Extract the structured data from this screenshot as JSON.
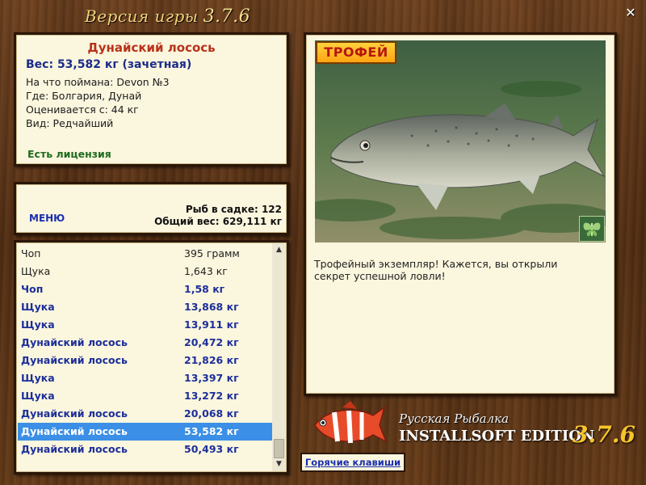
{
  "window": {
    "title": "Версия игры",
    "version": "3.7.6"
  },
  "fish": {
    "name": "Дунайский лосось",
    "weight": "Вес: 53,582 кг (зачетная)",
    "lines": [
      "На что поймана: Devon №3",
      "Где: Болгария, Дунай",
      "Оценивается с: 44 кг",
      "Вид: Редчайший"
    ],
    "license": "Есть лицензия"
  },
  "stats": {
    "menu_label": "МЕНЮ",
    "fish_in_keepnet": "Рыб в садке: 122",
    "total_weight": "Общий вес: 629,111 кг"
  },
  "catch_list": {
    "rows": [
      {
        "name": "Чоп",
        "weight": "395 грамм",
        "style": "light"
      },
      {
        "name": "Щука",
        "weight": "1,643 кг",
        "style": "light"
      },
      {
        "name": "Чоп",
        "weight": "1,58 кг",
        "style": "bold"
      },
      {
        "name": "Щука",
        "weight": "13,868 кг",
        "style": "bold"
      },
      {
        "name": "Щука",
        "weight": "13,911 кг",
        "style": "bold"
      },
      {
        "name": "Дунайский лосось",
        "weight": "20,472 кг",
        "style": "bold"
      },
      {
        "name": "Дунайский лосось",
        "weight": "21,826 кг",
        "style": "bold"
      },
      {
        "name": "Щука",
        "weight": "13,397 кг",
        "style": "bold"
      },
      {
        "name": "Щука",
        "weight": "13,272 кг",
        "style": "bold"
      },
      {
        "name": "Дунайский лосось",
        "weight": "20,068 кг",
        "style": "bold"
      },
      {
        "name": "Дунайский лосось",
        "weight": "53,582 кг",
        "style": "bold",
        "selected": true
      },
      {
        "name": "Дунайский лосось",
        "weight": "50,493 кг",
        "style": "bold"
      }
    ],
    "scroll_up_icon": "triangle-up-icon",
    "scroll_down_icon": "triangle-down-icon"
  },
  "photo": {
    "badge": "ТРОФЕЙ",
    "corner_icon": "butterfly-icon",
    "description": "Трофейный экземпляр! Кажется, вы открыли секрет успешной ловли!"
  },
  "branding": {
    "line1": "Русская Рыбалка",
    "line2": "INSTALLSOFT EDITION",
    "version": "3.7.6"
  },
  "hotkeys_label": "Горячие клавиши",
  "colors": {
    "selection": "#3b8fe6",
    "fish_name": "#b8321a",
    "link": "#1a2fb0",
    "license": "#1f6b1f",
    "badge": "#ffb81e"
  }
}
